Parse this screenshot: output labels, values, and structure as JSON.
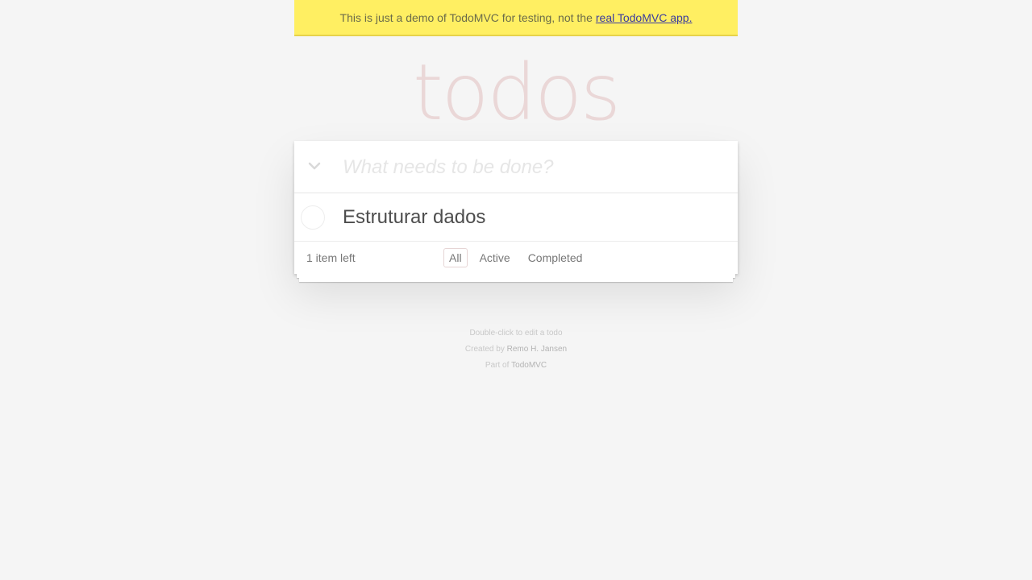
{
  "banner": {
    "text": "This is just a demo of TodoMVC for testing, not the",
    "link_text": "real TodoMVC app."
  },
  "app": {
    "title": "todos",
    "toggle_all_icon": "chevron-down-icon",
    "new_todo_placeholder": "What needs to be done?",
    "new_todo_value": ""
  },
  "todos": [
    {
      "label": "Estruturar dados",
      "completed": false
    }
  ],
  "footer": {
    "count_text": "1 item left",
    "filters": [
      {
        "label": "All",
        "selected": true
      },
      {
        "label": "Active",
        "selected": false
      },
      {
        "label": "Completed",
        "selected": false
      }
    ]
  },
  "info": {
    "hint": "Double-click to edit a todo",
    "created_prefix": "Created by",
    "author": "Remo H. Jansen",
    "part_prefix": "Part of",
    "part_link": "TodoMVC"
  },
  "colors": {
    "banner_bg": "#ffef62",
    "title": "#ead7d7",
    "background": "#f5f5f5"
  }
}
